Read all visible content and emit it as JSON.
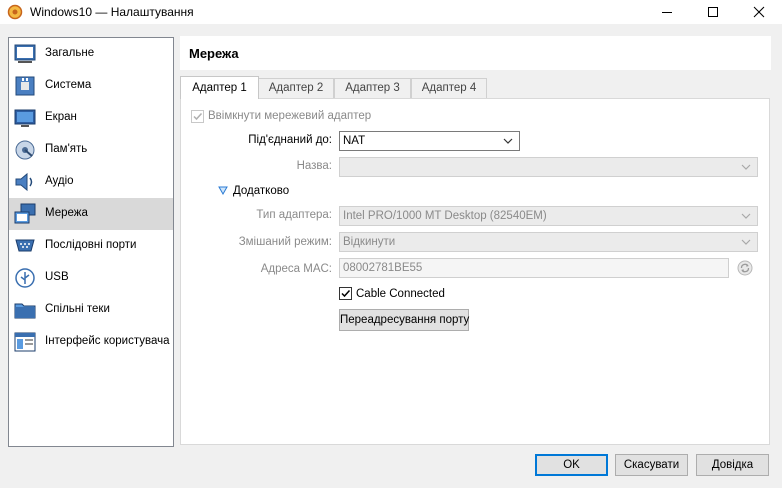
{
  "window": {
    "title": "Windows10 — Налаштування"
  },
  "sidebar": {
    "items": [
      {
        "label": "Загальне",
        "icon": "general-icon"
      },
      {
        "label": "Система",
        "icon": "system-icon"
      },
      {
        "label": "Екран",
        "icon": "display-icon"
      },
      {
        "label": "Пам'ять",
        "icon": "storage-icon"
      },
      {
        "label": "Аудіо",
        "icon": "audio-icon"
      },
      {
        "label": "Мережа",
        "icon": "network-icon",
        "active": true
      },
      {
        "label": "Послідовні порти",
        "icon": "serial-ports-icon"
      },
      {
        "label": "USB",
        "icon": "usb-icon"
      },
      {
        "label": "Спільні теки",
        "icon": "shared-folders-icon"
      },
      {
        "label": "Інтерфейс користувача",
        "icon": "user-interface-icon"
      }
    ]
  },
  "page": {
    "title": "Мережа"
  },
  "tabs": [
    {
      "label": "Адаптер 1",
      "active": true
    },
    {
      "label": "Адаптер 2"
    },
    {
      "label": "Адаптер 3"
    },
    {
      "label": "Адаптер 4"
    }
  ],
  "adapter": {
    "enable_label": "Ввімкнути мережевий адаптер",
    "enable_checked": true,
    "attached_label": "Під'єднаний до:",
    "attached_value": "NAT",
    "name_label": "Назва:",
    "name_value": "",
    "advanced_label": "Додатково",
    "type_label": "Тип адаптера:",
    "type_value": "Intel PRO/1000 MT Desktop (82540EM)",
    "promisc_label": "Змішаний режим:",
    "promisc_value": "Відкинути",
    "mac_label": "Адреса MAC:",
    "mac_value": "08002781BE55",
    "cable_label": "Cable Connected",
    "cable_checked": true,
    "port_forward_label": "Переадресування порту"
  },
  "buttons": {
    "ok": "OK",
    "cancel": "Скасувати",
    "help": "Довідка"
  },
  "colors": {
    "accent": "#0078d7",
    "selection": "#d9d9d9"
  }
}
